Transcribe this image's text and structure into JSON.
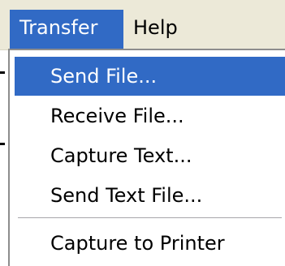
{
  "menubar": {
    "items": [
      {
        "label": "Transfer",
        "state": "open"
      },
      {
        "label": "Help"
      }
    ]
  },
  "transfer_menu": {
    "items": [
      {
        "label": "Send File...",
        "state": "highlighted"
      },
      {
        "label": "Receive File..."
      },
      {
        "label": "Capture Text..."
      },
      {
        "label": "Send Text File..."
      },
      {
        "label": "Capture to Printer"
      }
    ]
  },
  "colors": {
    "highlight": "#316ac5",
    "menubar_bg": "#ece9d8",
    "menu_bg": "#ffffff"
  }
}
